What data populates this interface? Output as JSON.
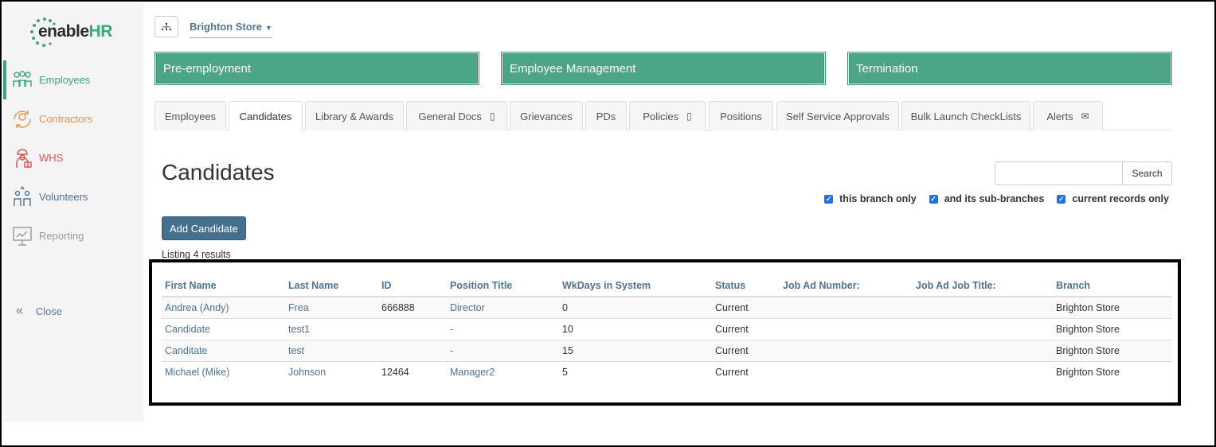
{
  "app": {
    "logo_prefix": "enable",
    "logo_suffix": "HR",
    "brand_color": "#3aa876"
  },
  "sidebar": {
    "items": [
      {
        "label": "Employees",
        "icon": "people-icon",
        "color": "#3aa876"
      },
      {
        "label": "Contractors",
        "icon": "contractor-cycle-icon",
        "color": "#e8934a"
      },
      {
        "label": "WHS",
        "icon": "safety-worker-icon",
        "color": "#d9534f"
      },
      {
        "label": "Volunteers",
        "icon": "volunteer-hands-icon",
        "color": "#4f7396"
      },
      {
        "label": "Reporting",
        "icon": "report-board-icon",
        "color": "#999999"
      }
    ],
    "close_label": "Close"
  },
  "header": {
    "branch": "Brighton Store"
  },
  "categories": [
    "Pre-employment",
    "Employee Management",
    "Termination"
  ],
  "tabs": [
    {
      "label": "Employees"
    },
    {
      "label": "Candidates",
      "active": true
    },
    {
      "label": "Library & Awards"
    },
    {
      "label": "General Docs",
      "icon": "mobile-icon"
    },
    {
      "label": "Grievances"
    },
    {
      "label": "PDs"
    },
    {
      "label": "Policies",
      "icon": "mobile-icon"
    },
    {
      "label": "Positions"
    },
    {
      "label": "Self Service Approvals"
    },
    {
      "label": "Bulk Launch CheckLists"
    },
    {
      "label": "Alerts",
      "icon": "envelope-icon"
    }
  ],
  "main": {
    "title": "Candidates",
    "search_label": "Search",
    "search_value": "",
    "filters": [
      "this branch only",
      "and its sub-branches",
      "current records only"
    ],
    "add_button": "Add Candidate",
    "listing": "Listing 4 results"
  },
  "table": {
    "columns": [
      "First Name",
      "Last Name",
      "ID",
      "Position Title",
      "WkDays in System",
      "Status",
      "Job Ad Number:",
      "Job Ad Job Title:",
      "Branch"
    ],
    "rows": [
      [
        "Andrea (Andy)",
        "Frea",
        "666888",
        "Director",
        "0",
        "Current",
        "",
        "",
        "Brighton Store"
      ],
      [
        "Candidate",
        "test1",
        "",
        "-",
        "10",
        "Current",
        "",
        "",
        "Brighton Store"
      ],
      [
        "Canditate",
        "test",
        "",
        "-",
        "15",
        "Current",
        "",
        "",
        "Brighton Store"
      ],
      [
        "Michael (Mike)",
        "Johnson",
        "12464",
        "Manager2",
        "5",
        "Current",
        "",
        "",
        "Brighton Store"
      ]
    ]
  }
}
